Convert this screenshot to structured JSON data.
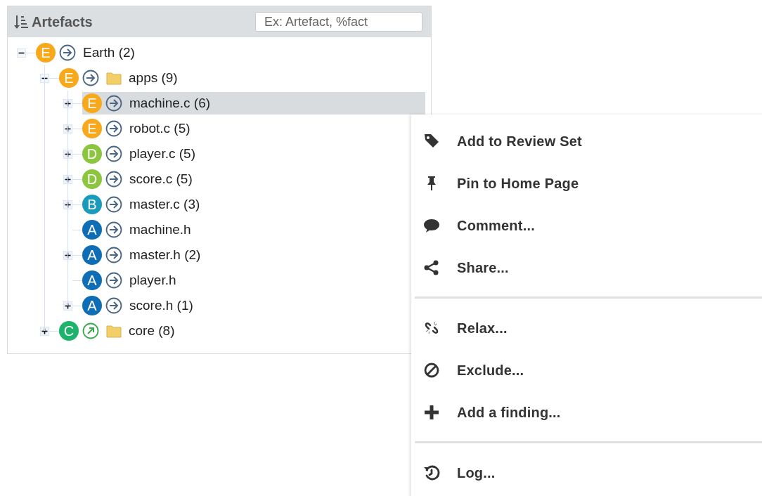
{
  "panel": {
    "title": "Artefacts",
    "search": {
      "placeholder": "Ex: Artefact, %fact"
    }
  },
  "tree": [
    {
      "label": "Earth (2)",
      "grade": "E",
      "color": "#f7a81b",
      "external": false,
      "folder": false,
      "expandable": true,
      "expanded": true,
      "selected": false,
      "children": [
        {
          "label": "apps (9)",
          "grade": "E",
          "color": "#f7a81b",
          "external": false,
          "folder": true,
          "expandable": true,
          "expanded": true,
          "selected": false,
          "children": [
            {
              "label": "machine.c (6)",
              "grade": "E",
              "color": "#f7a81b",
              "external": false,
              "folder": false,
              "expandable": true,
              "expanded": false,
              "selected": true
            },
            {
              "label": "robot.c (5)",
              "grade": "E",
              "color": "#f7a81b",
              "external": false,
              "folder": false,
              "expandable": true,
              "expanded": false,
              "selected": false
            },
            {
              "label": "player.c (5)",
              "grade": "D",
              "color": "#8cc63f",
              "external": false,
              "folder": false,
              "expandable": true,
              "expanded": false,
              "selected": false
            },
            {
              "label": "score.c (5)",
              "grade": "D",
              "color": "#8cc63f",
              "external": false,
              "folder": false,
              "expandable": true,
              "expanded": false,
              "selected": false
            },
            {
              "label": "master.c (3)",
              "grade": "B",
              "color": "#1a9bbc",
              "external": false,
              "folder": false,
              "expandable": true,
              "expanded": false,
              "selected": false
            },
            {
              "label": "machine.h",
              "grade": "A",
              "color": "#0f6db5",
              "external": false,
              "folder": false,
              "expandable": false,
              "selected": false
            },
            {
              "label": "master.h (2)",
              "grade": "A",
              "color": "#0f6db5",
              "external": false,
              "folder": false,
              "expandable": true,
              "expanded": false,
              "selected": false
            },
            {
              "label": "player.h",
              "grade": "A",
              "color": "#0f6db5",
              "external": false,
              "folder": false,
              "expandable": false,
              "selected": false
            },
            {
              "label": "score.h (1)",
              "grade": "A",
              "color": "#0f6db5",
              "external": false,
              "folder": false,
              "expandable": true,
              "expanded": false,
              "selected": false
            }
          ]
        },
        {
          "label": "core (8)",
          "grade": "C",
          "color": "#1db36b",
          "external": true,
          "folder": true,
          "expandable": true,
          "expanded": false,
          "selected": false
        }
      ]
    }
  ],
  "context_menu": {
    "groups": [
      [
        {
          "label": "Add to Review Set"
        },
        {
          "label": "Pin to Home Page"
        },
        {
          "label": "Comment..."
        },
        {
          "label": "Share..."
        }
      ],
      [
        {
          "label": "Relax..."
        },
        {
          "label": "Exclude..."
        },
        {
          "label": "Add a finding..."
        }
      ],
      [
        {
          "label": "Log..."
        }
      ]
    ]
  }
}
